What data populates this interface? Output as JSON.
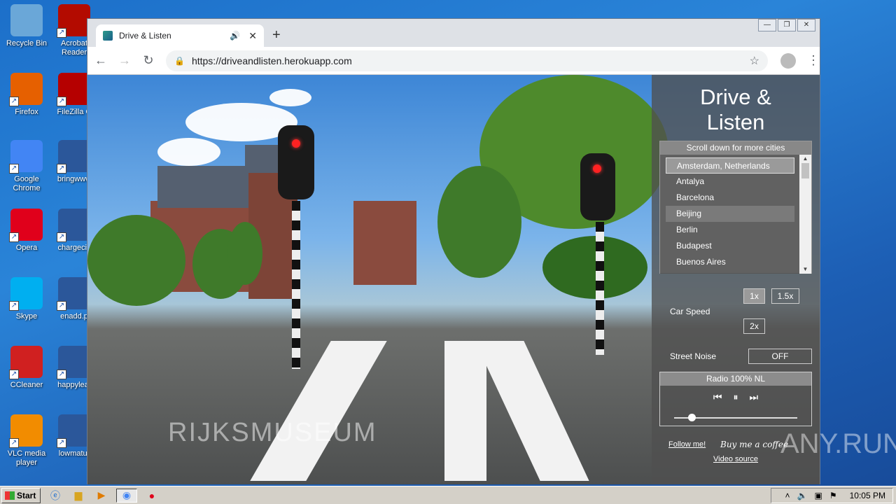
{
  "desktop": {
    "icons": [
      {
        "label": "Recycle Bin",
        "color": "#6aa7d8"
      },
      {
        "label": "Acrobat Reader",
        "color": "#b30b00"
      },
      {
        "label": "Firefox",
        "color": "#e66000"
      },
      {
        "label": "FileZilla C",
        "color": "#b50000"
      },
      {
        "label": "Google Chrome",
        "color": "#4285f4"
      },
      {
        "label": "bringwww",
        "color": "#2b579a"
      },
      {
        "label": "Opera",
        "color": "#e0001b"
      },
      {
        "label": "chargeciv",
        "color": "#2b579a"
      },
      {
        "label": "Skype",
        "color": "#00aff0"
      },
      {
        "label": "enadd.p",
        "color": "#2b579a"
      },
      {
        "label": "CCleaner",
        "color": "#d02020"
      },
      {
        "label": "happyleat",
        "color": "#2b579a"
      },
      {
        "label": "VLC media player",
        "color": "#f28c00"
      },
      {
        "label": "lowmatur",
        "color": "#2b579a"
      }
    ]
  },
  "browser": {
    "tab_title": "Drive & Listen",
    "url": "https://driveandlisten.herokuapp.com",
    "new_tab": "+",
    "tab_close": "✕",
    "tab_audio": "🔊"
  },
  "panel": {
    "title_line1": "Drive &",
    "title_line2": "Listen",
    "city_header": "Scroll down for more cities",
    "cities": [
      "Amsterdam, Netherlands",
      "Antalya",
      "Barcelona",
      "Beijing",
      "Berlin",
      "Budapest",
      "Buenos Aires"
    ],
    "selected_city": "Amsterdam, Netherlands",
    "car_speed_label": "Car Speed",
    "speed_options": [
      "1x",
      "1.5x",
      "2x"
    ],
    "active_speed": "1x",
    "street_noise_label": "Street Noise",
    "street_noise_value": "OFF",
    "radio_station": "Radio 100% NL",
    "volume": 0.14,
    "follow_link": "Follow me!",
    "coffee_link": "Buy me a coffee",
    "video_source_link": "Video source"
  },
  "video": {
    "overlay_text": "RIJKSMUSEUM"
  },
  "watermark": "ANY.RUN",
  "taskbar": {
    "start_label": "Start",
    "clock": "10:05 PM"
  }
}
